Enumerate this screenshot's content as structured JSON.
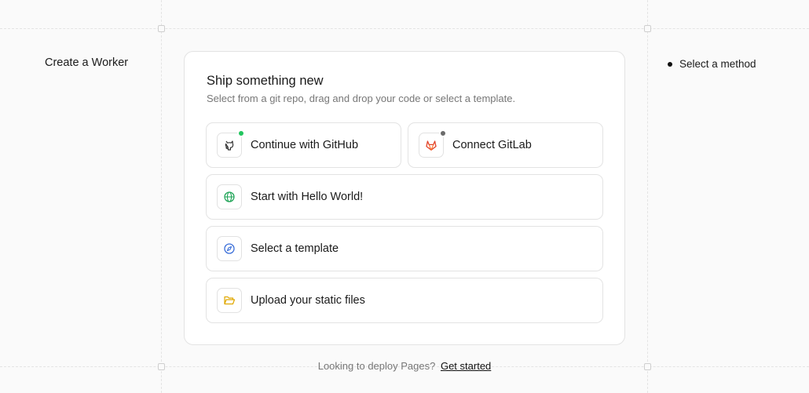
{
  "left_panel": {
    "title": "Create a Worker"
  },
  "right_panel": {
    "step_label": "Select a method"
  },
  "card": {
    "title": "Ship something new",
    "subtitle": "Select from a git repo, drag and drop your code or select a template."
  },
  "options": {
    "github": {
      "label": "Continue with GitHub",
      "icon": "github-icon",
      "status_color": "#22c55e"
    },
    "gitlab": {
      "label": "Connect GitLab",
      "icon": "gitlab-icon",
      "status_color": "#6b6b6b"
    },
    "hello_world": {
      "label": "Start with Hello World!",
      "icon": "globe-icon",
      "color": "#22a559"
    },
    "template": {
      "label": "Select a template",
      "icon": "compass-icon",
      "color": "#3b6fd9"
    },
    "upload": {
      "label": "Upload your static files",
      "icon": "folder-open-icon",
      "color": "#e0a800"
    }
  },
  "footer": {
    "prompt": "Looking to deploy Pages?",
    "link": "Get started"
  }
}
